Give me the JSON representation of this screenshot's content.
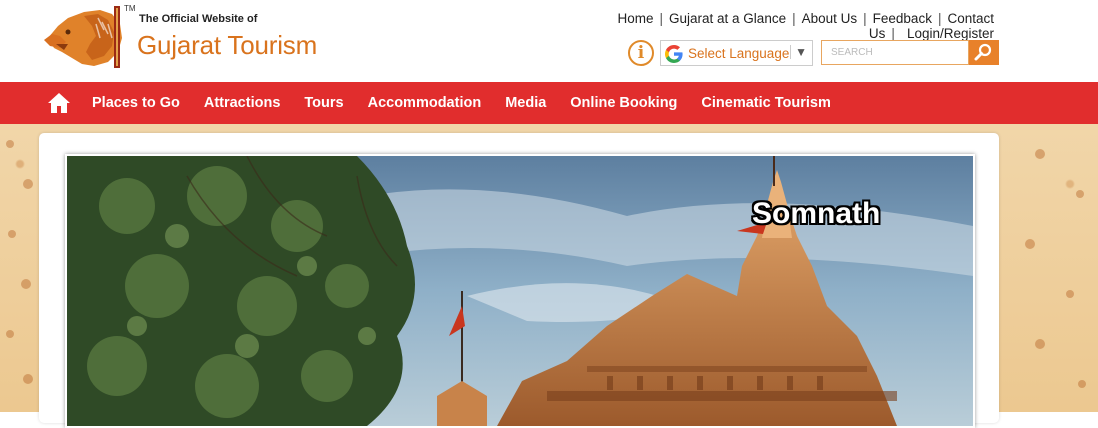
{
  "header": {
    "tm": "TM",
    "tagline": "The Official Website of",
    "brand": "Gujarat Tourism",
    "top_links": [
      "Home",
      "Gujarat at a Glance",
      "About Us",
      "Feedback",
      "Contact Us"
    ],
    "login_label": "Login/Register",
    "info_icon": "i",
    "language_label": "Select Language",
    "language_caret": "▼",
    "search_placeholder": "SEARCH"
  },
  "nav": {
    "items": [
      "Places to Go",
      "Attractions",
      "Tours",
      "Accommodation",
      "Media",
      "Online Booking",
      "Cinematic Tourism"
    ]
  },
  "slider": {
    "caption": "Somnath"
  },
  "colors": {
    "brand_orange": "#d9731d",
    "nav_red": "#e12d2d",
    "search_button": "#e8812a"
  }
}
